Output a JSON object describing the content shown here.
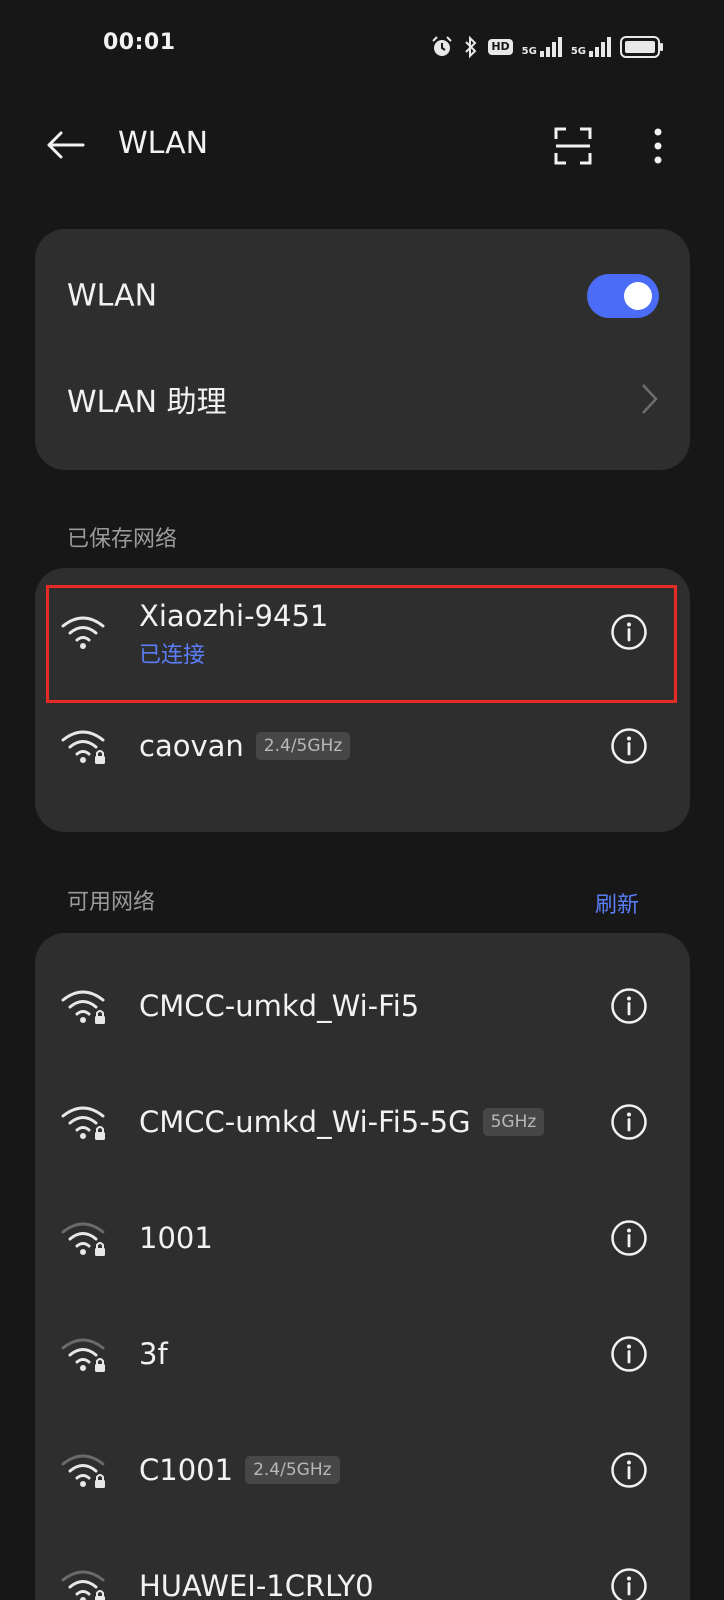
{
  "status_bar": {
    "time": "00:01",
    "hd_label": "HD",
    "signal_1_label": "5G",
    "signal_2_label": "5G"
  },
  "app_bar": {
    "title": "WLAN"
  },
  "wlan_card": {
    "toggle_label": "WLAN",
    "toggle_on": true,
    "assistant_label": "WLAN 助理"
  },
  "saved": {
    "section_label": "已保存网络",
    "networks": [
      {
        "name": "Xiaozhi-9451",
        "status": "已连接",
        "badge": "",
        "secured": false
      },
      {
        "name": "caovan",
        "status": "",
        "badge": "2.4/5GHz",
        "secured": true
      }
    ]
  },
  "available": {
    "section_label": "可用网络",
    "refresh_label": "刷新",
    "networks": [
      {
        "name": "CMCC-umkd_Wi-Fi5",
        "badge": "",
        "strength": "strong"
      },
      {
        "name": "CMCC-umkd_Wi-Fi5-5G",
        "badge": "5GHz",
        "strength": "strong"
      },
      {
        "name": "1001",
        "badge": "",
        "strength": "medium"
      },
      {
        "name": "3f",
        "badge": "",
        "strength": "medium"
      },
      {
        "name": "C1001",
        "badge": "2.4/5GHz",
        "strength": "medium"
      },
      {
        "name": "HUAWEI-1CRLY0",
        "badge": "",
        "strength": "medium"
      }
    ]
  },
  "colors": {
    "background": "#171717",
    "card": "#2e2e2e",
    "accent": "#5b7ef8",
    "toggle": "#4a6cf7",
    "highlight": "#e52b24"
  }
}
